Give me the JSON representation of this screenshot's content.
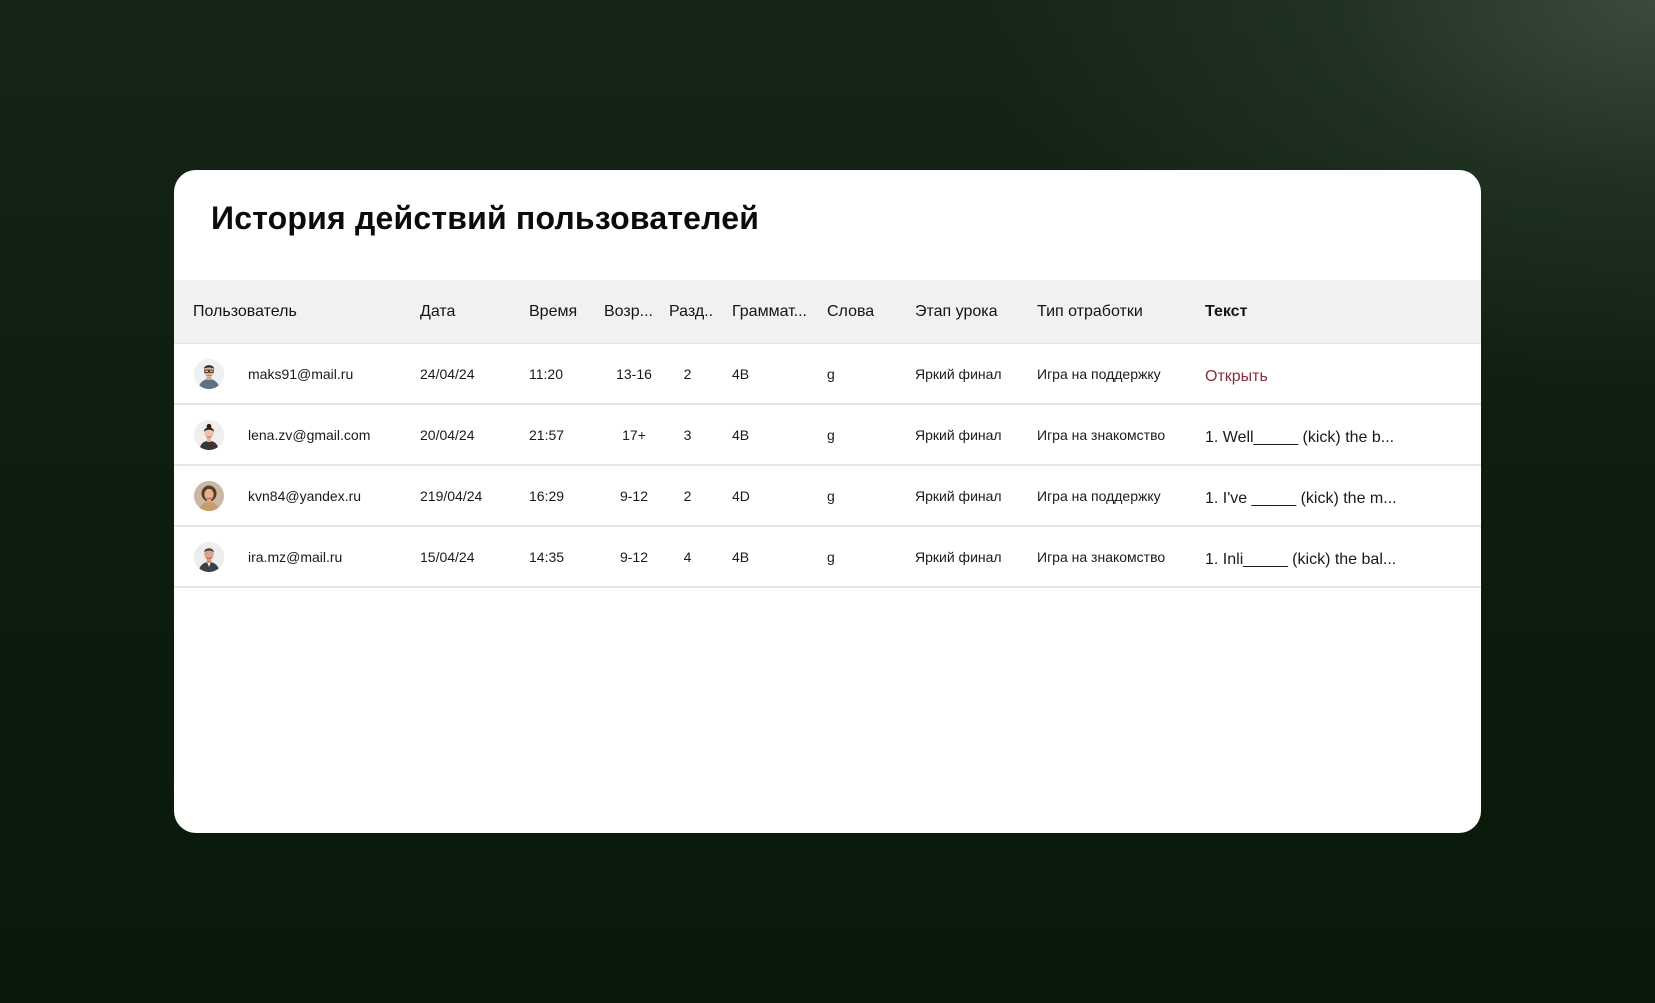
{
  "page": {
    "title": "История действий пользователей"
  },
  "table": {
    "columns": {
      "user": "Пользователь",
      "date": "Дата",
      "time": "Время",
      "age": "Возр...",
      "section": "Разд..",
      "grammar": "Граммат...",
      "words": "Слова",
      "stage": "Этап урока",
      "type": "Тип отработки",
      "text": "Текст"
    },
    "rows": [
      {
        "email": "maks91@mail.ru",
        "date": "24/04/24",
        "time": "11:20",
        "age": "13-16",
        "section": "2",
        "grammar": "4B",
        "words": "g",
        "stage": "Яркий финал",
        "type": "Игра на поддержку",
        "text": "Открыть",
        "avatar_icon": "man-with-glasses-avatar"
      },
      {
        "email": "lena.zv@gmail.com",
        "date": "20/04/24",
        "time": "21:57",
        "age": "17+",
        "section": "3",
        "grammar": "4B",
        "words": "g",
        "stage": "Яркий финал",
        "type": "Игра на знакомство",
        "text": "1. Well_____ (kick) the b...",
        "avatar_icon": "woman-avatar"
      },
      {
        "email": "kvn84@yandex.ru",
        "date": "219/04/24",
        "time": "16:29",
        "age": "9-12",
        "section": "2",
        "grammar": "4D",
        "words": "g",
        "stage": "Яркий финал",
        "type": "Игра на поддержку",
        "text": "1. I've _____ (kick) the m...",
        "avatar_icon": "woman-curly-hair-avatar"
      },
      {
        "email": "ira.mz@mail.ru",
        "date": "15/04/24",
        "time": "14:35",
        "age": "9-12",
        "section": "4",
        "grammar": "4B",
        "words": "g",
        "stage": "Яркий финал",
        "type": "Игра на знакомство",
        "text": "1. Inli_____ (kick) the bal...",
        "avatar_icon": "man-avatar"
      }
    ]
  },
  "colors": {
    "link": "#8a2e3e",
    "header_bg": "#f1f1f1",
    "card_bg": "#ffffff"
  }
}
